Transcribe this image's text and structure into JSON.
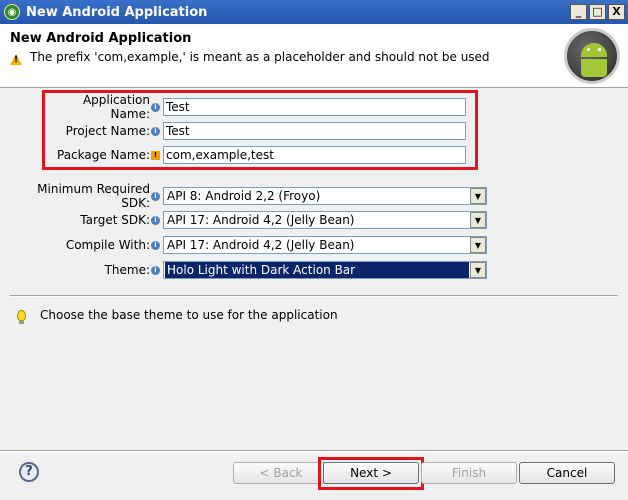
{
  "window": {
    "title": "New Android Application",
    "minimize": "_",
    "maximize": "□",
    "close": "X"
  },
  "header": {
    "title": "New Android Application",
    "message": "The prefix 'com,example,' is meant as a placeholder and should not be used"
  },
  "fields": {
    "app_name": {
      "label": "Application Name:",
      "value": "Test"
    },
    "project_name": {
      "label": "Project Name:",
      "value": "Test"
    },
    "package_name": {
      "label": "Package Name:",
      "value": "com,example,test"
    }
  },
  "sdk": {
    "min_sdk": {
      "label": "Minimum Required SDK:",
      "value": "API 8: Android 2,2 (Froyo)"
    },
    "target_sdk": {
      "label": "Target SDK:",
      "value": "API 17: Android 4,2 (Jelly Bean)"
    },
    "compile_with": {
      "label": "Compile With:",
      "value": "API 17: Android 4,2 (Jelly Bean)"
    },
    "theme": {
      "label": "Theme:",
      "value": "Holo Light with Dark Action Bar"
    }
  },
  "hint": "Choose the base theme to use for the application",
  "buttons": {
    "help": "?",
    "back": "< Back",
    "next": "Next >",
    "finish": "Finish",
    "cancel": "Cancel"
  },
  "icons": {
    "info": "i",
    "warn": "!"
  },
  "colors": {
    "highlight_box": "#e0141e",
    "selection": "#0a246a",
    "titlebar": "#2d5fb8"
  }
}
